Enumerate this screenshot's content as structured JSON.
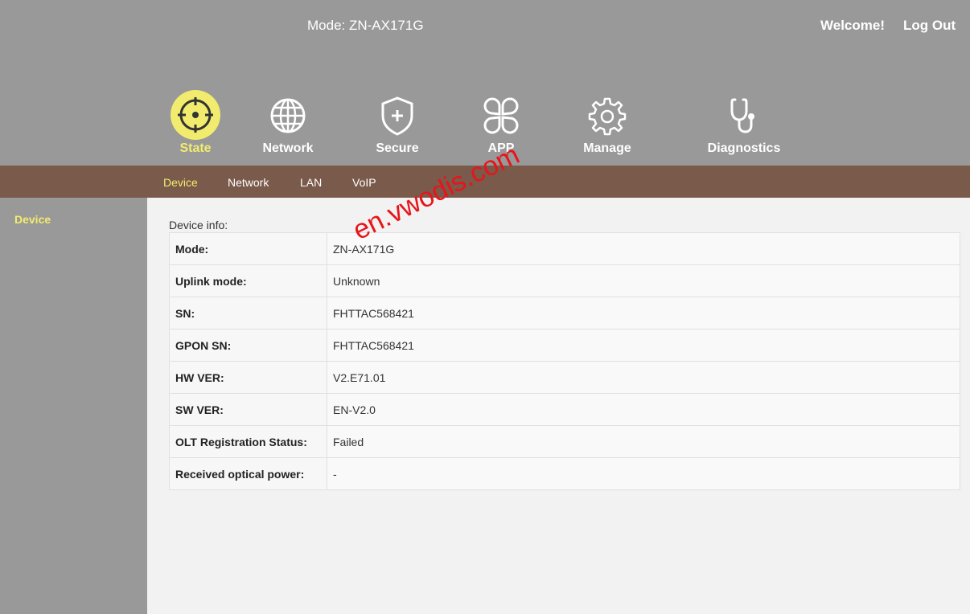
{
  "header": {
    "mode_title": "Mode: ZN-AX171G",
    "welcome": "Welcome!",
    "logout": "Log Out"
  },
  "nav": [
    {
      "label": "State",
      "icon": "crosshair-icon",
      "active": true
    },
    {
      "label": "Network",
      "icon": "globe-icon"
    },
    {
      "label": "Secure",
      "icon": "shield-plus-icon"
    },
    {
      "label": "APP",
      "icon": "apps-icon"
    },
    {
      "label": "Manage",
      "icon": "gear-icon"
    },
    {
      "label": "Diagnostics",
      "icon": "stethoscope-icon"
    }
  ],
  "subnav": [
    {
      "label": "Device",
      "active": true
    },
    {
      "label": "Network"
    },
    {
      "label": "LAN"
    },
    {
      "label": "VoIP"
    }
  ],
  "sidebar": {
    "items": [
      {
        "label": "Device"
      }
    ]
  },
  "device_info": {
    "title": "Device info:",
    "rows": [
      {
        "key": "Mode:",
        "value": "ZN-AX171G"
      },
      {
        "key": "Uplink mode:",
        "value": "Unknown"
      },
      {
        "key": "SN:",
        "value": "FHTTAC568421"
      },
      {
        "key": "GPON SN:",
        "value": "FHTTAC568421"
      },
      {
        "key": "HW VER:",
        "value": "V2.E71.01"
      },
      {
        "key": "SW VER:",
        "value": "EN-V2.0"
      },
      {
        "key": "OLT Registration Status:",
        "value": "Failed"
      },
      {
        "key": "Received optical power:",
        "value": "-"
      }
    ]
  },
  "watermark": "en.vwodis.com",
  "colors": {
    "header_bg": "#999999",
    "subnav_bg": "#7a5a4a",
    "accent_yellow": "#f2ec6e",
    "watermark_red": "#e8141b"
  }
}
